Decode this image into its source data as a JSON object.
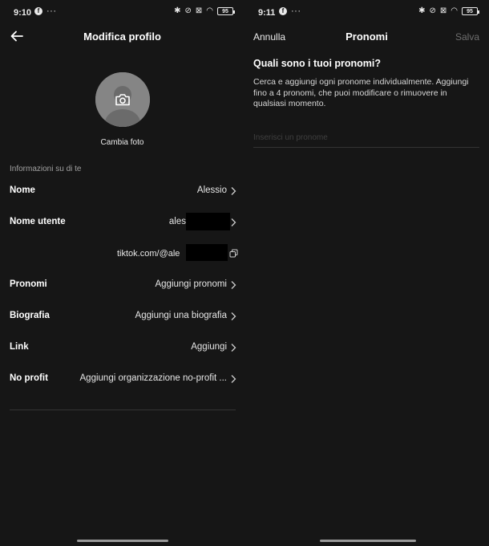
{
  "left": {
    "status": {
      "time": "9:10",
      "fb_glyph": "f",
      "dots": "···",
      "battery": "95"
    },
    "header": {
      "title": "Modifica profilo"
    },
    "avatar": {
      "change_photo": "Cambia foto"
    },
    "section_label": "Informazioni su di te",
    "rows": [
      {
        "label": "Nome",
        "value": "Alessio"
      },
      {
        "label": "Nome utente",
        "value": "ales"
      },
      {
        "label": "Pronomi",
        "value": "Aggiungi pronomi"
      },
      {
        "label": "Biografia",
        "value": "Aggiungi una biografia"
      },
      {
        "label": "Link",
        "value": "Aggiungi"
      },
      {
        "label": "No profit",
        "value": "Aggiungi organizzazione no-profit ..."
      }
    ],
    "profile_url": "tiktok.com/@ale"
  },
  "right": {
    "status": {
      "time": "9:11",
      "fb_glyph": "f",
      "dots": "···",
      "battery": "95"
    },
    "header": {
      "cancel": "Annulla",
      "title": "Pronomi",
      "save": "Salva"
    },
    "question": "Quali sono i tuoi pronomi?",
    "description": "Cerca e aggiungi ogni pronome individualmente. Aggiungi fino a 4 pronomi, che puoi modificare o rimuovere in qualsiasi momento.",
    "input": {
      "placeholder": "Inserisci un pronome",
      "value": ""
    }
  },
  "colors": {
    "background": "#161616",
    "text": "#ffffff",
    "muted": "#a0a0a0",
    "disabled": "#6e6e6e",
    "divider": "#333333"
  },
  "icons": [
    "back-arrow-icon",
    "camera-icon",
    "chevron-right-icon",
    "copy-icon",
    "facebook-icon",
    "bluetooth-icon",
    "mute-icon",
    "sim-icon",
    "wifi-icon",
    "battery-icon"
  ]
}
